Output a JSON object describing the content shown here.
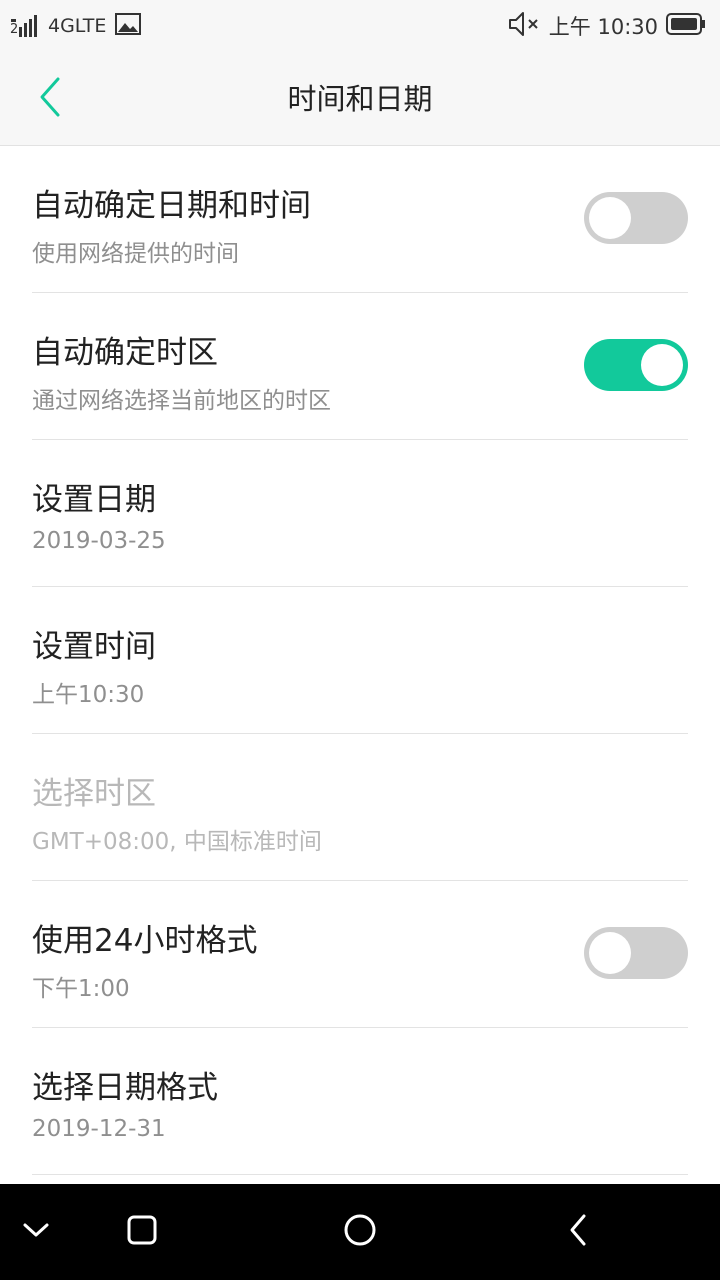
{
  "status_bar": {
    "sim_label": "2",
    "network": "4GLTE",
    "time": "上午 10:30"
  },
  "header": {
    "title": "时间和日期"
  },
  "settings": [
    {
      "label": "自动确定日期和时间",
      "sub": "使用网络提供的时间",
      "toggle": "off"
    },
    {
      "label": "自动确定时区",
      "sub": "通过网络选择当前地区的时区",
      "toggle": "on"
    },
    {
      "label": "设置日期",
      "sub": "2019-03-25"
    },
    {
      "label": "设置时间",
      "sub": "上午10:30"
    },
    {
      "label": "选择时区",
      "sub": "GMT+08:00, 中国标准时间",
      "disabled": true
    },
    {
      "label": "使用24小时格式",
      "sub": "下午1:00",
      "toggle": "off"
    },
    {
      "label": "选择日期格式",
      "sub": "2019-12-31"
    }
  ],
  "colors": {
    "accent": "#12c99b",
    "toggle_off": "#cfcfcf",
    "header_bg": "#f7f7f7",
    "nav_bg": "#000000"
  },
  "icons": {
    "back": "chevron-left-icon",
    "signal": "signal-icon",
    "image": "image-icon",
    "mute": "volume-mute-icon",
    "battery": "battery-icon",
    "nav": [
      "chevron-down-icon",
      "square-icon",
      "circle-icon",
      "chevron-left-icon"
    ]
  }
}
